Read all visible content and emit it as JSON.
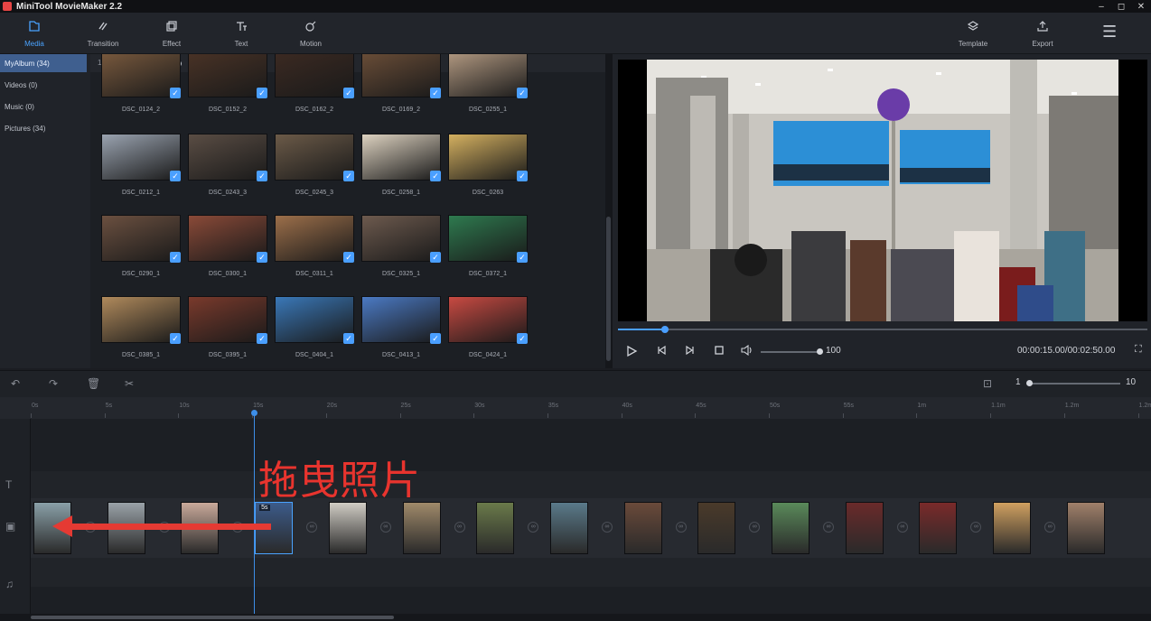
{
  "app": {
    "title": "MiniTool MovieMaker 2.2",
    "window_buttons": [
      "–",
      "◻",
      "✕"
    ]
  },
  "toolbar": {
    "media": "Media",
    "transition": "Transition",
    "effect": "Effect",
    "text": "Text",
    "motion": "Motion",
    "template": "Template",
    "export": "Export",
    "menu": "☰"
  },
  "nav": {
    "items": [
      {
        "label": "MyAlbum",
        "count": "(34)"
      },
      {
        "label": "Videos",
        "count": "(0)"
      },
      {
        "label": "Music",
        "count": "(0)"
      },
      {
        "label": "Pictures",
        "count": "(34)"
      }
    ]
  },
  "zoom": {
    "min": "1",
    "max": "100"
  },
  "media": {
    "check": "✓",
    "rows": [
      [
        "DSC_0124_2",
        "DSC_0152_2",
        "DSC_0162_2",
        "DSC_0169_2",
        "DSC_0255_1"
      ],
      [
        "DSC_0212_1",
        "DSC_0243_3",
        "DSC_0245_3",
        "DSC_0258_1",
        "DSC_0263"
      ],
      [
        "DSC_0290_1",
        "DSC_0300_1",
        "DSC_0311_1",
        "DSC_0325_1",
        "DSC_0372_1"
      ],
      [
        "DSC_0385_1",
        "DSC_0395_1",
        "DSC_0404_1",
        "DSC_0413_1",
        "DSC_0424_1"
      ]
    ]
  },
  "player": {
    "volume": "100",
    "timecode": "00:00:15.00/00:02:50.00",
    "progress": 0.088
  },
  "timeline": {
    "zoom_min": "1",
    "zoom_max": "10",
    "ticks": [
      "0s",
      "5s",
      "10s",
      "15s",
      "20s",
      "25s",
      "30s",
      "35s",
      "40s",
      "45s",
      "50s",
      "55s",
      "1m",
      "1.1m",
      "1.2m",
      "1.2m"
    ],
    "selected_clip_duration": "5s",
    "clip_count": 15,
    "annotation": "拖曳照片"
  },
  "colors": {
    "accent": "#4a9fff",
    "annotation": "#e53a33"
  }
}
